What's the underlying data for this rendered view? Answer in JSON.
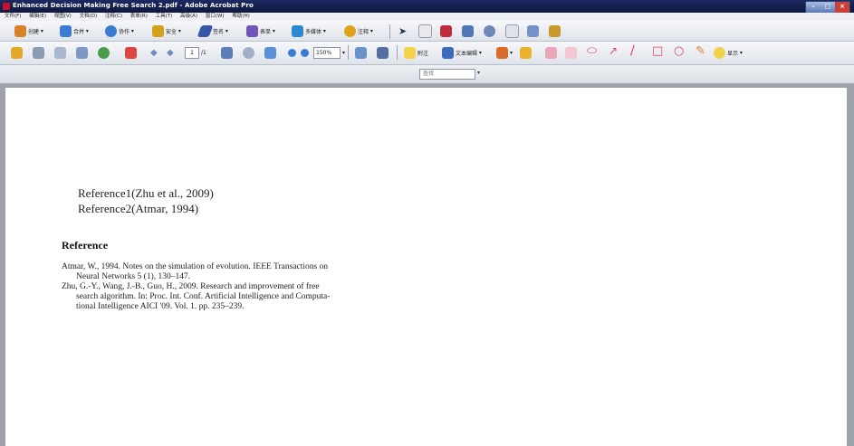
{
  "window": {
    "title": "Enhanced Decision Making Free Search 2.pdf - Adobe Acrobat Pro",
    "controls": {
      "minimize": "–",
      "maximize": "□",
      "close": "×"
    }
  },
  "menubar": [
    "文件(F)",
    "编辑(E)",
    "视图(V)",
    "文档(D)",
    "注释(C)",
    "表单(R)",
    "工具(T)",
    "高级(A)",
    "窗口(W)",
    "帮助(H)"
  ],
  "toolbar1": {
    "items": [
      {
        "label": "创建",
        "icon": "create-icon",
        "color": "#d9822b"
      },
      {
        "label": "合并",
        "icon": "combine-icon",
        "color": "#3b7bd1"
      },
      {
        "label": "协作",
        "icon": "collaborate-icon",
        "color": "#3b7bd1"
      },
      {
        "label": "安全",
        "icon": "lock-icon",
        "color": "#d3a017"
      },
      {
        "label": "签名",
        "icon": "sign-icon",
        "color": "#3656a8"
      },
      {
        "label": "表单",
        "icon": "forms-icon",
        "color": "#6f56b8"
      },
      {
        "label": "多媒体",
        "icon": "multimedia-icon",
        "color": "#2b8ad1"
      },
      {
        "label": "注释",
        "icon": "comment-icon",
        "color": "#e0a21a"
      }
    ]
  },
  "toolbar2": {
    "page_number": "1",
    "page_total": "/1",
    "zoom": "150%",
    "attach_label": "附注",
    "textedit_label": "文本编辑",
    "show_label": "显示"
  },
  "find": {
    "placeholder": "查找"
  },
  "document": {
    "reference_lines": [
      "Reference1(Zhu et al., 2009)",
      "Reference2(Atmar, 1994)"
    ],
    "heading": "Reference",
    "bibliography": [
      [
        "Atmar, W., 1994. Notes on the simulation of evolution. IEEE Transactions on",
        "Neural Networks 5 (1), 130–147."
      ],
      [
        "Zhu, G.-Y., Wang, J.-B., Guo, H., 2009. Research and improvement of free",
        "search algorithm. In: Proc. Int. Conf. Artificial Intelligence and Computa-",
        "tional Intelligence AICI '09. Vol. 1. pp. 235–239."
      ]
    ]
  }
}
